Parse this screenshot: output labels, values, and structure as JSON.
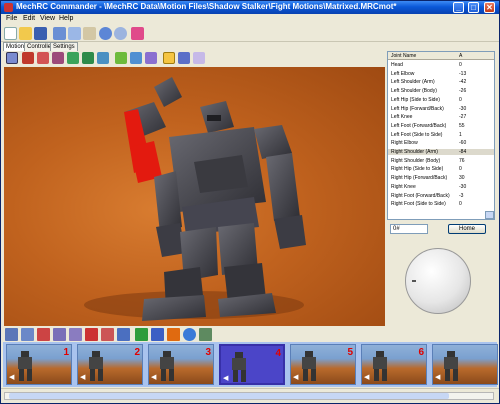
{
  "window": {
    "title": "MechRC Commander - \\MechRC Data\\Motion Files\\Shadow Stalker\\Fight Motions\\Matrixed.MRCmot*",
    "minimize": "_",
    "maximize": "□",
    "close": "✕"
  },
  "menu": {
    "items": [
      "File",
      "Edit",
      "View",
      "Help"
    ]
  },
  "tabs": [
    {
      "label": "Motion"
    },
    {
      "label": "Controller"
    },
    {
      "label": "Settings"
    }
  ],
  "joints": {
    "headers": [
      "Joint Name",
      "A"
    ],
    "rows": [
      {
        "name": "Head",
        "value": "0"
      },
      {
        "name": "Left Elbow",
        "value": "-13"
      },
      {
        "name": "Left Shoulder (Arm)",
        "value": "-42"
      },
      {
        "name": "Left Shoulder (Body)",
        "value": "-26"
      },
      {
        "name": "Left Hip (Side to Side)",
        "value": "0"
      },
      {
        "name": "Left Hip (Forward/Back)",
        "value": "-30"
      },
      {
        "name": "Left Knee",
        "value": "-27"
      },
      {
        "name": "Left Foot (Forward/Back)",
        "value": "55"
      },
      {
        "name": "Left Foot (Side to Side)",
        "value": "1"
      },
      {
        "name": "Right Elbow",
        "value": "-60"
      },
      {
        "name": "Right Shoulder (Arm)",
        "value": "-84"
      },
      {
        "name": "Right Shoulder (Body)",
        "value": "76"
      },
      {
        "name": "Right Hip (Side to Side)",
        "value": "0"
      },
      {
        "name": "Right Hip (Forward/Back)",
        "value": "30"
      },
      {
        "name": "Right Knee",
        "value": "-30"
      },
      {
        "name": "Right Foot (Forward/Back)",
        "value": "-3"
      },
      {
        "name": "Right Foot (Side to Side)",
        "value": "0"
      }
    ],
    "selected_index": 10
  },
  "controls": {
    "frame_value": "0#",
    "home_label": "Home"
  },
  "frames": [
    {
      "number": "1",
      "label": ""
    },
    {
      "number": "2",
      "label": ""
    },
    {
      "number": "3",
      "label": ""
    },
    {
      "number": "4",
      "label": "",
      "selected": true
    },
    {
      "number": "5",
      "label": ""
    },
    {
      "number": "6",
      "label": ""
    },
    {
      "number": "",
      "label": ""
    }
  ],
  "colors": {
    "selected_limb": "#e31a0f",
    "robot_body": "#4d4d55",
    "ground": "#c0621e",
    "frame_selected": "#4b45c8"
  }
}
